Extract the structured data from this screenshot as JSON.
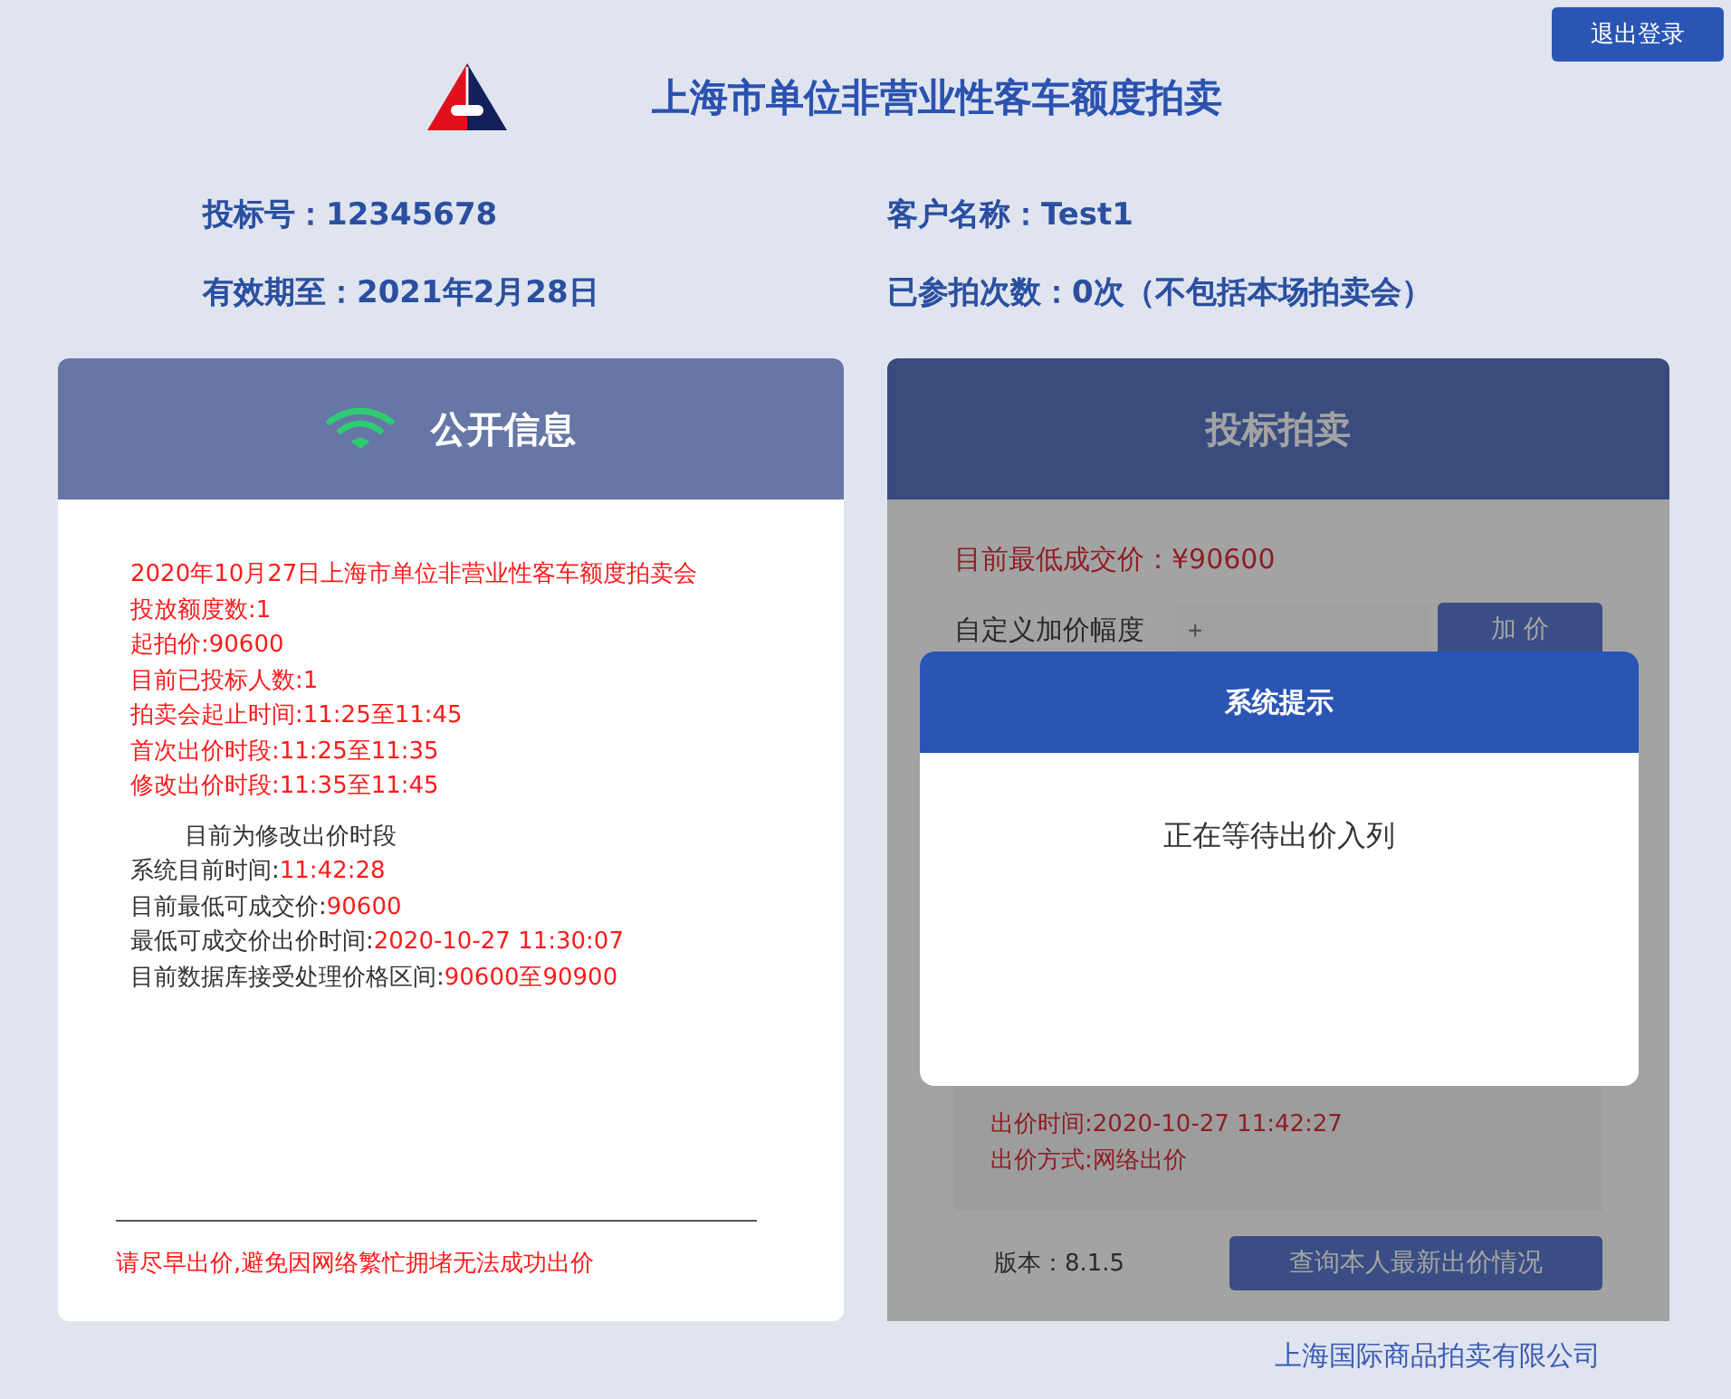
{
  "header": {
    "title": "上海市单位非营业性客车额度拍卖",
    "logout_button": "退出登录"
  },
  "info": [
    {
      "label": "投标号：",
      "value": "12345678"
    },
    {
      "label": "客户名称：",
      "value": "Test1"
    },
    {
      "label": "有效期至：",
      "value": "2021年2月28日"
    },
    {
      "label": "已参拍次数：",
      "value": "0次（不包括本场拍卖会）"
    }
  ],
  "public_info": {
    "title": "公开信息",
    "announcement": [
      "2020年10月27日上海市单位非营业性客车额度拍卖会",
      "投放额度数:1",
      "起拍价:90600",
      "目前已投标人数:1",
      "拍卖会起止时间:11:25至11:45",
      "首次出价时段:11:25至11:35",
      "修改出价时段:11:35至11:45"
    ],
    "status": "目前为修改出价时段",
    "details": [
      {
        "label": "系统目前时间:",
        "value": "11:42:28"
      },
      {
        "label": "目前最低可成交价:",
        "value": "90600"
      },
      {
        "label": "最低可成交价出价时间:",
        "value": "2020-10-27 11:30:07"
      },
      {
        "label": "目前数据库接受处理价格区间:",
        "value": "90600至90900"
      }
    ],
    "notice": "请尽早出价,避免因网络繁忙拥堵无法成功出价"
  },
  "bidding": {
    "title": "投标拍卖",
    "lowest_price": "目前最低成交价：¥90600",
    "increment_label": "自定义加价幅度",
    "increment_placeholder": "+",
    "raise_button": "加 价",
    "record": [
      "出价时间:2020-10-27 11:42:27",
      "出价方式:网络出价"
    ],
    "version": "版本：8.1.5",
    "query_button": "查询本人最新出价情况"
  },
  "dialog": {
    "title": "系统提示",
    "message": "正在等待出价入列"
  },
  "footer": {
    "company": "上海国际商品拍卖有限公司"
  }
}
